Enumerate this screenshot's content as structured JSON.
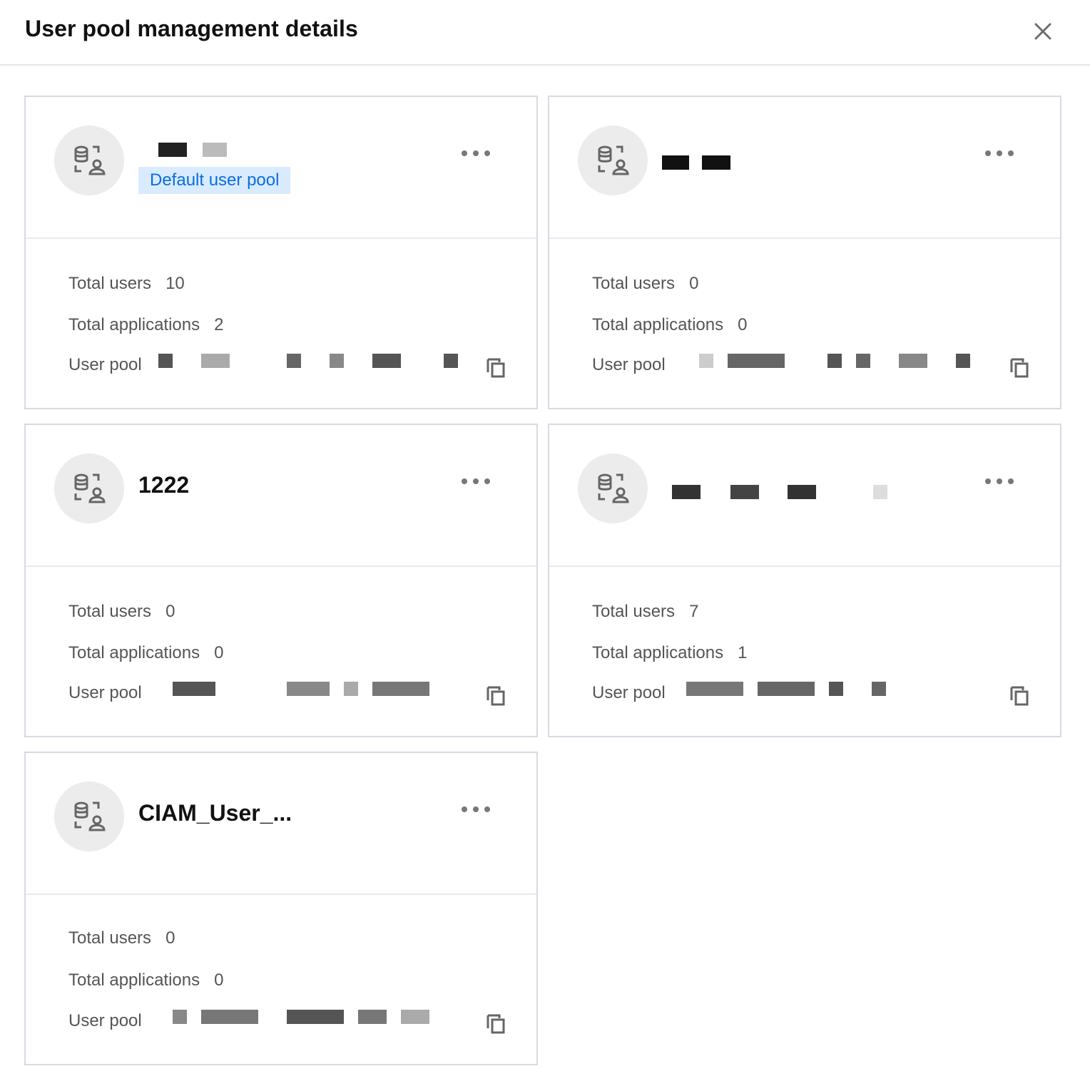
{
  "dialog": {
    "title": "User pool management details"
  },
  "labels": {
    "total_users": "Total users",
    "total_applications": "Total applications",
    "user_pool": "User pool"
  },
  "cards": [
    {
      "name": "",
      "tag": "Default user pool",
      "total_users": "10",
      "total_applications": "2"
    },
    {
      "name": "",
      "tag": "",
      "total_users": "0",
      "total_applications": "0"
    },
    {
      "name": "1222",
      "tag": "",
      "total_users": "0",
      "total_applications": "0"
    },
    {
      "name": "",
      "tag": "",
      "total_users": "7",
      "total_applications": "1"
    },
    {
      "name": "CIAM_User_...",
      "tag": "",
      "total_users": "0",
      "total_applications": "0"
    }
  ],
  "colors": {
    "accent": "#0a6de0",
    "tag_bg": "#d9ebff",
    "border": "#d6dae4"
  }
}
